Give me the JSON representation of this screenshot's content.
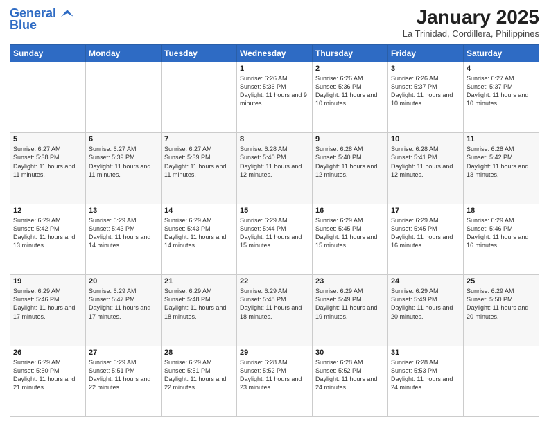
{
  "logo": {
    "line1": "General",
    "line2": "Blue"
  },
  "title": "January 2025",
  "subtitle": "La Trinidad, Cordillera, Philippines",
  "days_of_week": [
    "Sunday",
    "Monday",
    "Tuesday",
    "Wednesday",
    "Thursday",
    "Friday",
    "Saturday"
  ],
  "weeks": [
    [
      {
        "day": "",
        "info": ""
      },
      {
        "day": "",
        "info": ""
      },
      {
        "day": "",
        "info": ""
      },
      {
        "day": "1",
        "info": "Sunrise: 6:26 AM\nSunset: 5:36 PM\nDaylight: 11 hours and 9 minutes."
      },
      {
        "day": "2",
        "info": "Sunrise: 6:26 AM\nSunset: 5:36 PM\nDaylight: 11 hours and 10 minutes."
      },
      {
        "day": "3",
        "info": "Sunrise: 6:26 AM\nSunset: 5:37 PM\nDaylight: 11 hours and 10 minutes."
      },
      {
        "day": "4",
        "info": "Sunrise: 6:27 AM\nSunset: 5:37 PM\nDaylight: 11 hours and 10 minutes."
      }
    ],
    [
      {
        "day": "5",
        "info": "Sunrise: 6:27 AM\nSunset: 5:38 PM\nDaylight: 11 hours and 11 minutes."
      },
      {
        "day": "6",
        "info": "Sunrise: 6:27 AM\nSunset: 5:39 PM\nDaylight: 11 hours and 11 minutes."
      },
      {
        "day": "7",
        "info": "Sunrise: 6:27 AM\nSunset: 5:39 PM\nDaylight: 11 hours and 11 minutes."
      },
      {
        "day": "8",
        "info": "Sunrise: 6:28 AM\nSunset: 5:40 PM\nDaylight: 11 hours and 12 minutes."
      },
      {
        "day": "9",
        "info": "Sunrise: 6:28 AM\nSunset: 5:40 PM\nDaylight: 11 hours and 12 minutes."
      },
      {
        "day": "10",
        "info": "Sunrise: 6:28 AM\nSunset: 5:41 PM\nDaylight: 11 hours and 12 minutes."
      },
      {
        "day": "11",
        "info": "Sunrise: 6:28 AM\nSunset: 5:42 PM\nDaylight: 11 hours and 13 minutes."
      }
    ],
    [
      {
        "day": "12",
        "info": "Sunrise: 6:29 AM\nSunset: 5:42 PM\nDaylight: 11 hours and 13 minutes."
      },
      {
        "day": "13",
        "info": "Sunrise: 6:29 AM\nSunset: 5:43 PM\nDaylight: 11 hours and 14 minutes."
      },
      {
        "day": "14",
        "info": "Sunrise: 6:29 AM\nSunset: 5:43 PM\nDaylight: 11 hours and 14 minutes."
      },
      {
        "day": "15",
        "info": "Sunrise: 6:29 AM\nSunset: 5:44 PM\nDaylight: 11 hours and 15 minutes."
      },
      {
        "day": "16",
        "info": "Sunrise: 6:29 AM\nSunset: 5:45 PM\nDaylight: 11 hours and 15 minutes."
      },
      {
        "day": "17",
        "info": "Sunrise: 6:29 AM\nSunset: 5:45 PM\nDaylight: 11 hours and 16 minutes."
      },
      {
        "day": "18",
        "info": "Sunrise: 6:29 AM\nSunset: 5:46 PM\nDaylight: 11 hours and 16 minutes."
      }
    ],
    [
      {
        "day": "19",
        "info": "Sunrise: 6:29 AM\nSunset: 5:46 PM\nDaylight: 11 hours and 17 minutes."
      },
      {
        "day": "20",
        "info": "Sunrise: 6:29 AM\nSunset: 5:47 PM\nDaylight: 11 hours and 17 minutes."
      },
      {
        "day": "21",
        "info": "Sunrise: 6:29 AM\nSunset: 5:48 PM\nDaylight: 11 hours and 18 minutes."
      },
      {
        "day": "22",
        "info": "Sunrise: 6:29 AM\nSunset: 5:48 PM\nDaylight: 11 hours and 18 minutes."
      },
      {
        "day": "23",
        "info": "Sunrise: 6:29 AM\nSunset: 5:49 PM\nDaylight: 11 hours and 19 minutes."
      },
      {
        "day": "24",
        "info": "Sunrise: 6:29 AM\nSunset: 5:49 PM\nDaylight: 11 hours and 20 minutes."
      },
      {
        "day": "25",
        "info": "Sunrise: 6:29 AM\nSunset: 5:50 PM\nDaylight: 11 hours and 20 minutes."
      }
    ],
    [
      {
        "day": "26",
        "info": "Sunrise: 6:29 AM\nSunset: 5:50 PM\nDaylight: 11 hours and 21 minutes."
      },
      {
        "day": "27",
        "info": "Sunrise: 6:29 AM\nSunset: 5:51 PM\nDaylight: 11 hours and 22 minutes."
      },
      {
        "day": "28",
        "info": "Sunrise: 6:29 AM\nSunset: 5:51 PM\nDaylight: 11 hours and 22 minutes."
      },
      {
        "day": "29",
        "info": "Sunrise: 6:28 AM\nSunset: 5:52 PM\nDaylight: 11 hours and 23 minutes."
      },
      {
        "day": "30",
        "info": "Sunrise: 6:28 AM\nSunset: 5:52 PM\nDaylight: 11 hours and 24 minutes."
      },
      {
        "day": "31",
        "info": "Sunrise: 6:28 AM\nSunset: 5:53 PM\nDaylight: 11 hours and 24 minutes."
      },
      {
        "day": "",
        "info": ""
      }
    ]
  ]
}
